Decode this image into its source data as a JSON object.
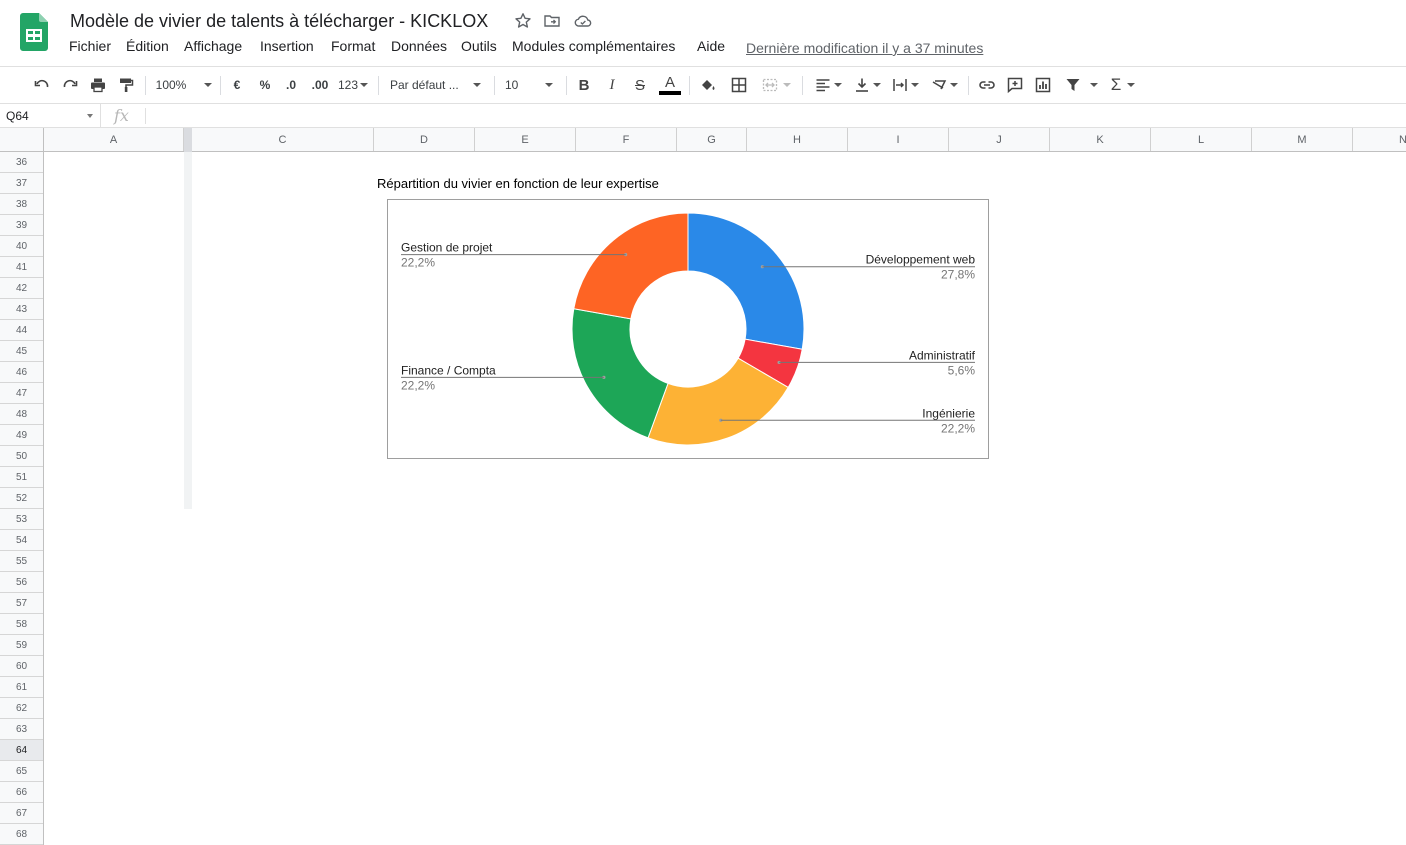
{
  "app": {
    "title": "Modèle de vivier de talents à télécharger - KICKLOX",
    "last_edit": "Dernière modification il y a 37 minutes",
    "menu": [
      "Fichier",
      "Édition",
      "Affichage",
      "Insertion",
      "Format",
      "Données",
      "Outils",
      "Modules complémentaires",
      "Aide"
    ]
  },
  "toolbar": {
    "zoom": "100%",
    "currency": "€",
    "percent": "%",
    "decimal_decrease": ".0",
    "decimal_increase": ".00",
    "number_format": "123",
    "font": "Par défaut ...",
    "font_size": "10",
    "bold": "B",
    "italic": "I",
    "strike": "S",
    "text_color": "A"
  },
  "formula_bar": {
    "name_box": "Q64",
    "fx": "fx"
  },
  "grid": {
    "columns": [
      "A",
      "C",
      "D",
      "E",
      "F",
      "G",
      "H",
      "I",
      "J",
      "K",
      "L",
      "M",
      "N"
    ],
    "rows": [
      "36",
      "37",
      "38",
      "39",
      "40",
      "41",
      "42",
      "43",
      "44",
      "45",
      "46",
      "47",
      "48",
      "49",
      "50",
      "51",
      "52",
      "53",
      "54",
      "55",
      "56",
      "57",
      "58",
      "59",
      "60",
      "61",
      "62",
      "63",
      "64",
      "65",
      "66",
      "67",
      "68"
    ],
    "selected_row": "64"
  },
  "chart_data": {
    "type": "pie",
    "title": "Répartition du vivier en fonction de leur expertise",
    "donut": true,
    "slices": [
      {
        "name": "Développement web",
        "value": 27.8,
        "label": "27,8%",
        "color": "#2a89e8"
      },
      {
        "name": "Administratif",
        "value": 5.6,
        "label": "5,6%",
        "color": "#f43540"
      },
      {
        "name": "Ingénierie",
        "value": 22.2,
        "label": "22,2%",
        "color": "#fdb235"
      },
      {
        "name": "Finance / Compta",
        "value": 22.2,
        "label": "22,2%",
        "color": "#1da657"
      },
      {
        "name": "Gestion de projet",
        "value": 22.2,
        "label": "22,2%",
        "color": "#fe6424"
      }
    ]
  }
}
